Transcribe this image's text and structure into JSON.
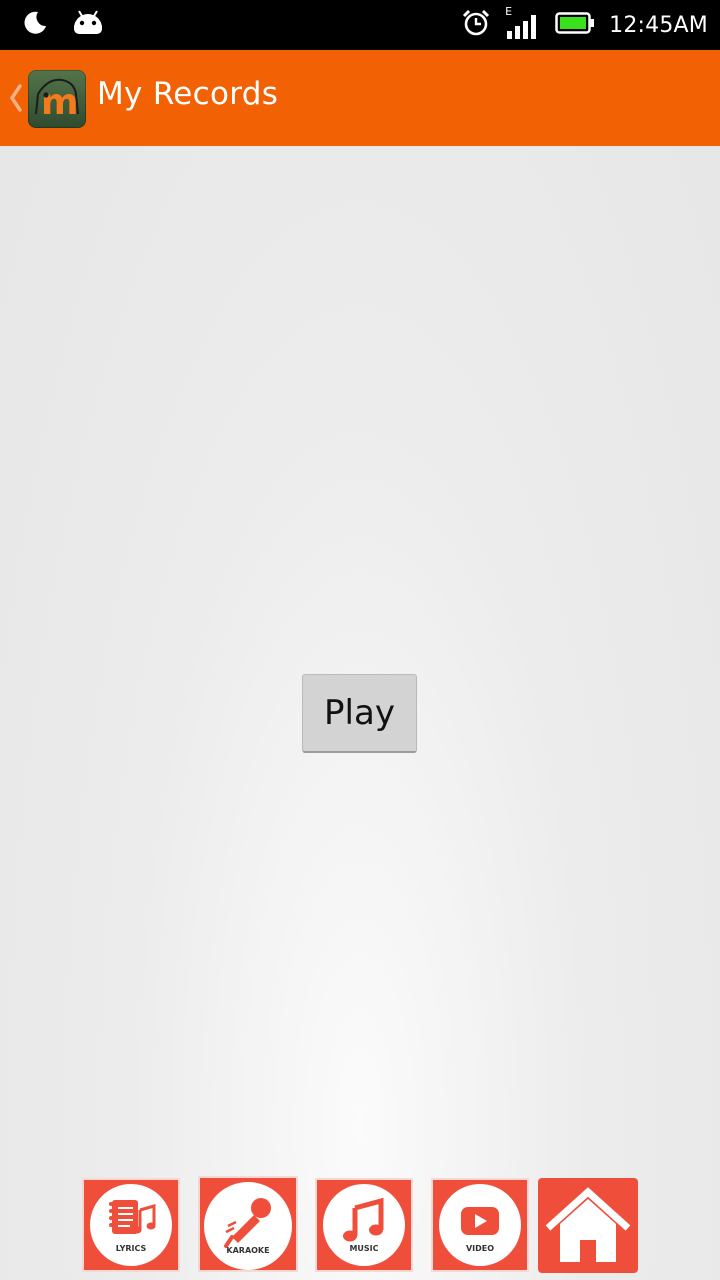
{
  "status_bar": {
    "time": "12:45AM",
    "network_type": "E",
    "icons": [
      "moon-icon",
      "android-icon",
      "alarm-icon",
      "signal-icon",
      "battery-icon"
    ]
  },
  "app_bar": {
    "title": "My Records",
    "logo_letter": "m",
    "color": "#f26205"
  },
  "main": {
    "play_label": "Play"
  },
  "bottom_nav": {
    "items": [
      {
        "label": "LYRICS",
        "icon": "lyrics-icon"
      },
      {
        "label": "KARAOKE",
        "icon": "microphone-icon"
      },
      {
        "label": "MUSIC",
        "icon": "music-note-icon"
      },
      {
        "label": "VIDEO",
        "icon": "video-play-icon"
      },
      {
        "label": "",
        "icon": "home-icon"
      }
    ],
    "accent_color": "#ef4e3a"
  }
}
